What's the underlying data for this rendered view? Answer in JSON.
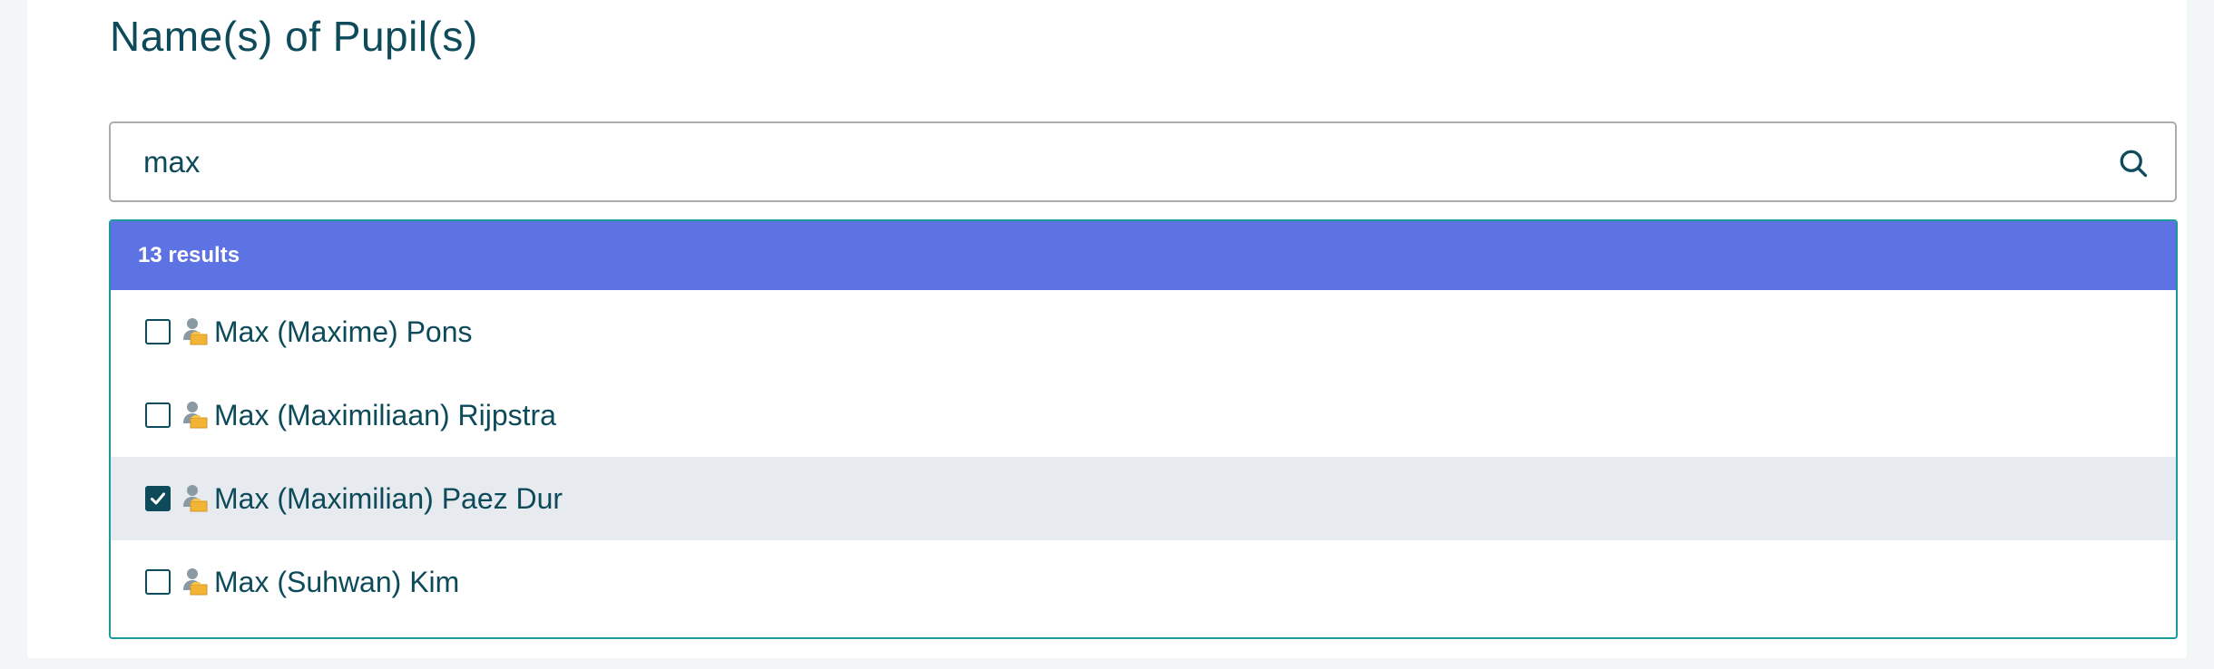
{
  "section": {
    "title": "Name(s) of Pupil(s)"
  },
  "search": {
    "value": "max"
  },
  "results": {
    "count_label": "13 results",
    "items": [
      {
        "label": "Max (Maxime) Pons",
        "checked": false
      },
      {
        "label": "Max (Maximiliaan) Rijpstra",
        "checked": false
      },
      {
        "label": "Max (Maximilian) Paez Dur",
        "checked": true
      },
      {
        "label": "Max (Suhwan) Kim",
        "checked": false
      }
    ]
  },
  "colors": {
    "accent": "#5e73e3",
    "text": "#0d4a5a",
    "border_active": "#1a9a98",
    "selected_row": "#e7eaee",
    "icon_body": "#f1b434",
    "icon_head": "#8a9aa4"
  },
  "icons": {
    "search": "search-icon",
    "pupil": "pupil-icon",
    "check": "checkmark-icon"
  }
}
